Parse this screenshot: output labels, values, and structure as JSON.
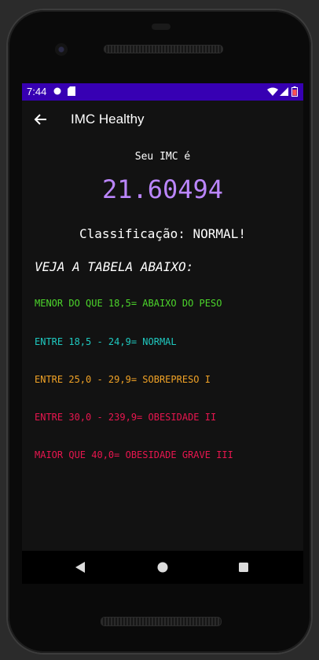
{
  "status_bar": {
    "time": "7:44",
    "left_icons": [
      "sim-icon",
      "sd-card-icon"
    ],
    "right_icons": [
      "wifi-icon",
      "signal-icon",
      "battery-icon"
    ],
    "color": "#3700b3"
  },
  "app_bar": {
    "back_icon": "arrow-back-icon",
    "title": "IMC Healthy"
  },
  "result": {
    "label": "Seu IMC é",
    "value": "21.60494",
    "classification": "Classificação: NORMAL!",
    "value_color": "#bb86fc"
  },
  "table": {
    "heading": "VEJA A TABELA ABAIXO:",
    "rows": [
      {
        "text": "MENOR DO QUE 18,5= ABAIXO DO PESO",
        "color": "#4cd62b"
      },
      {
        "text": "ENTRE 18,5 - 24,9= NORMAL",
        "color": "#1fc9c0"
      },
      {
        "text": "ENTRE 25,0 - 29,9= SOBREPRESO I",
        "color": "#f0a226"
      },
      {
        "text": "ENTRE 30,0 - 239,9= OBESIDADE II",
        "color": "#e8164f"
      },
      {
        "text": "MAIOR QUE 40,0= OBESIDADE GRAVE III",
        "color": "#e8164f"
      }
    ]
  },
  "nav_bar": {
    "buttons": [
      "back-triangle-icon",
      "home-circle-icon",
      "recents-square-icon"
    ]
  }
}
